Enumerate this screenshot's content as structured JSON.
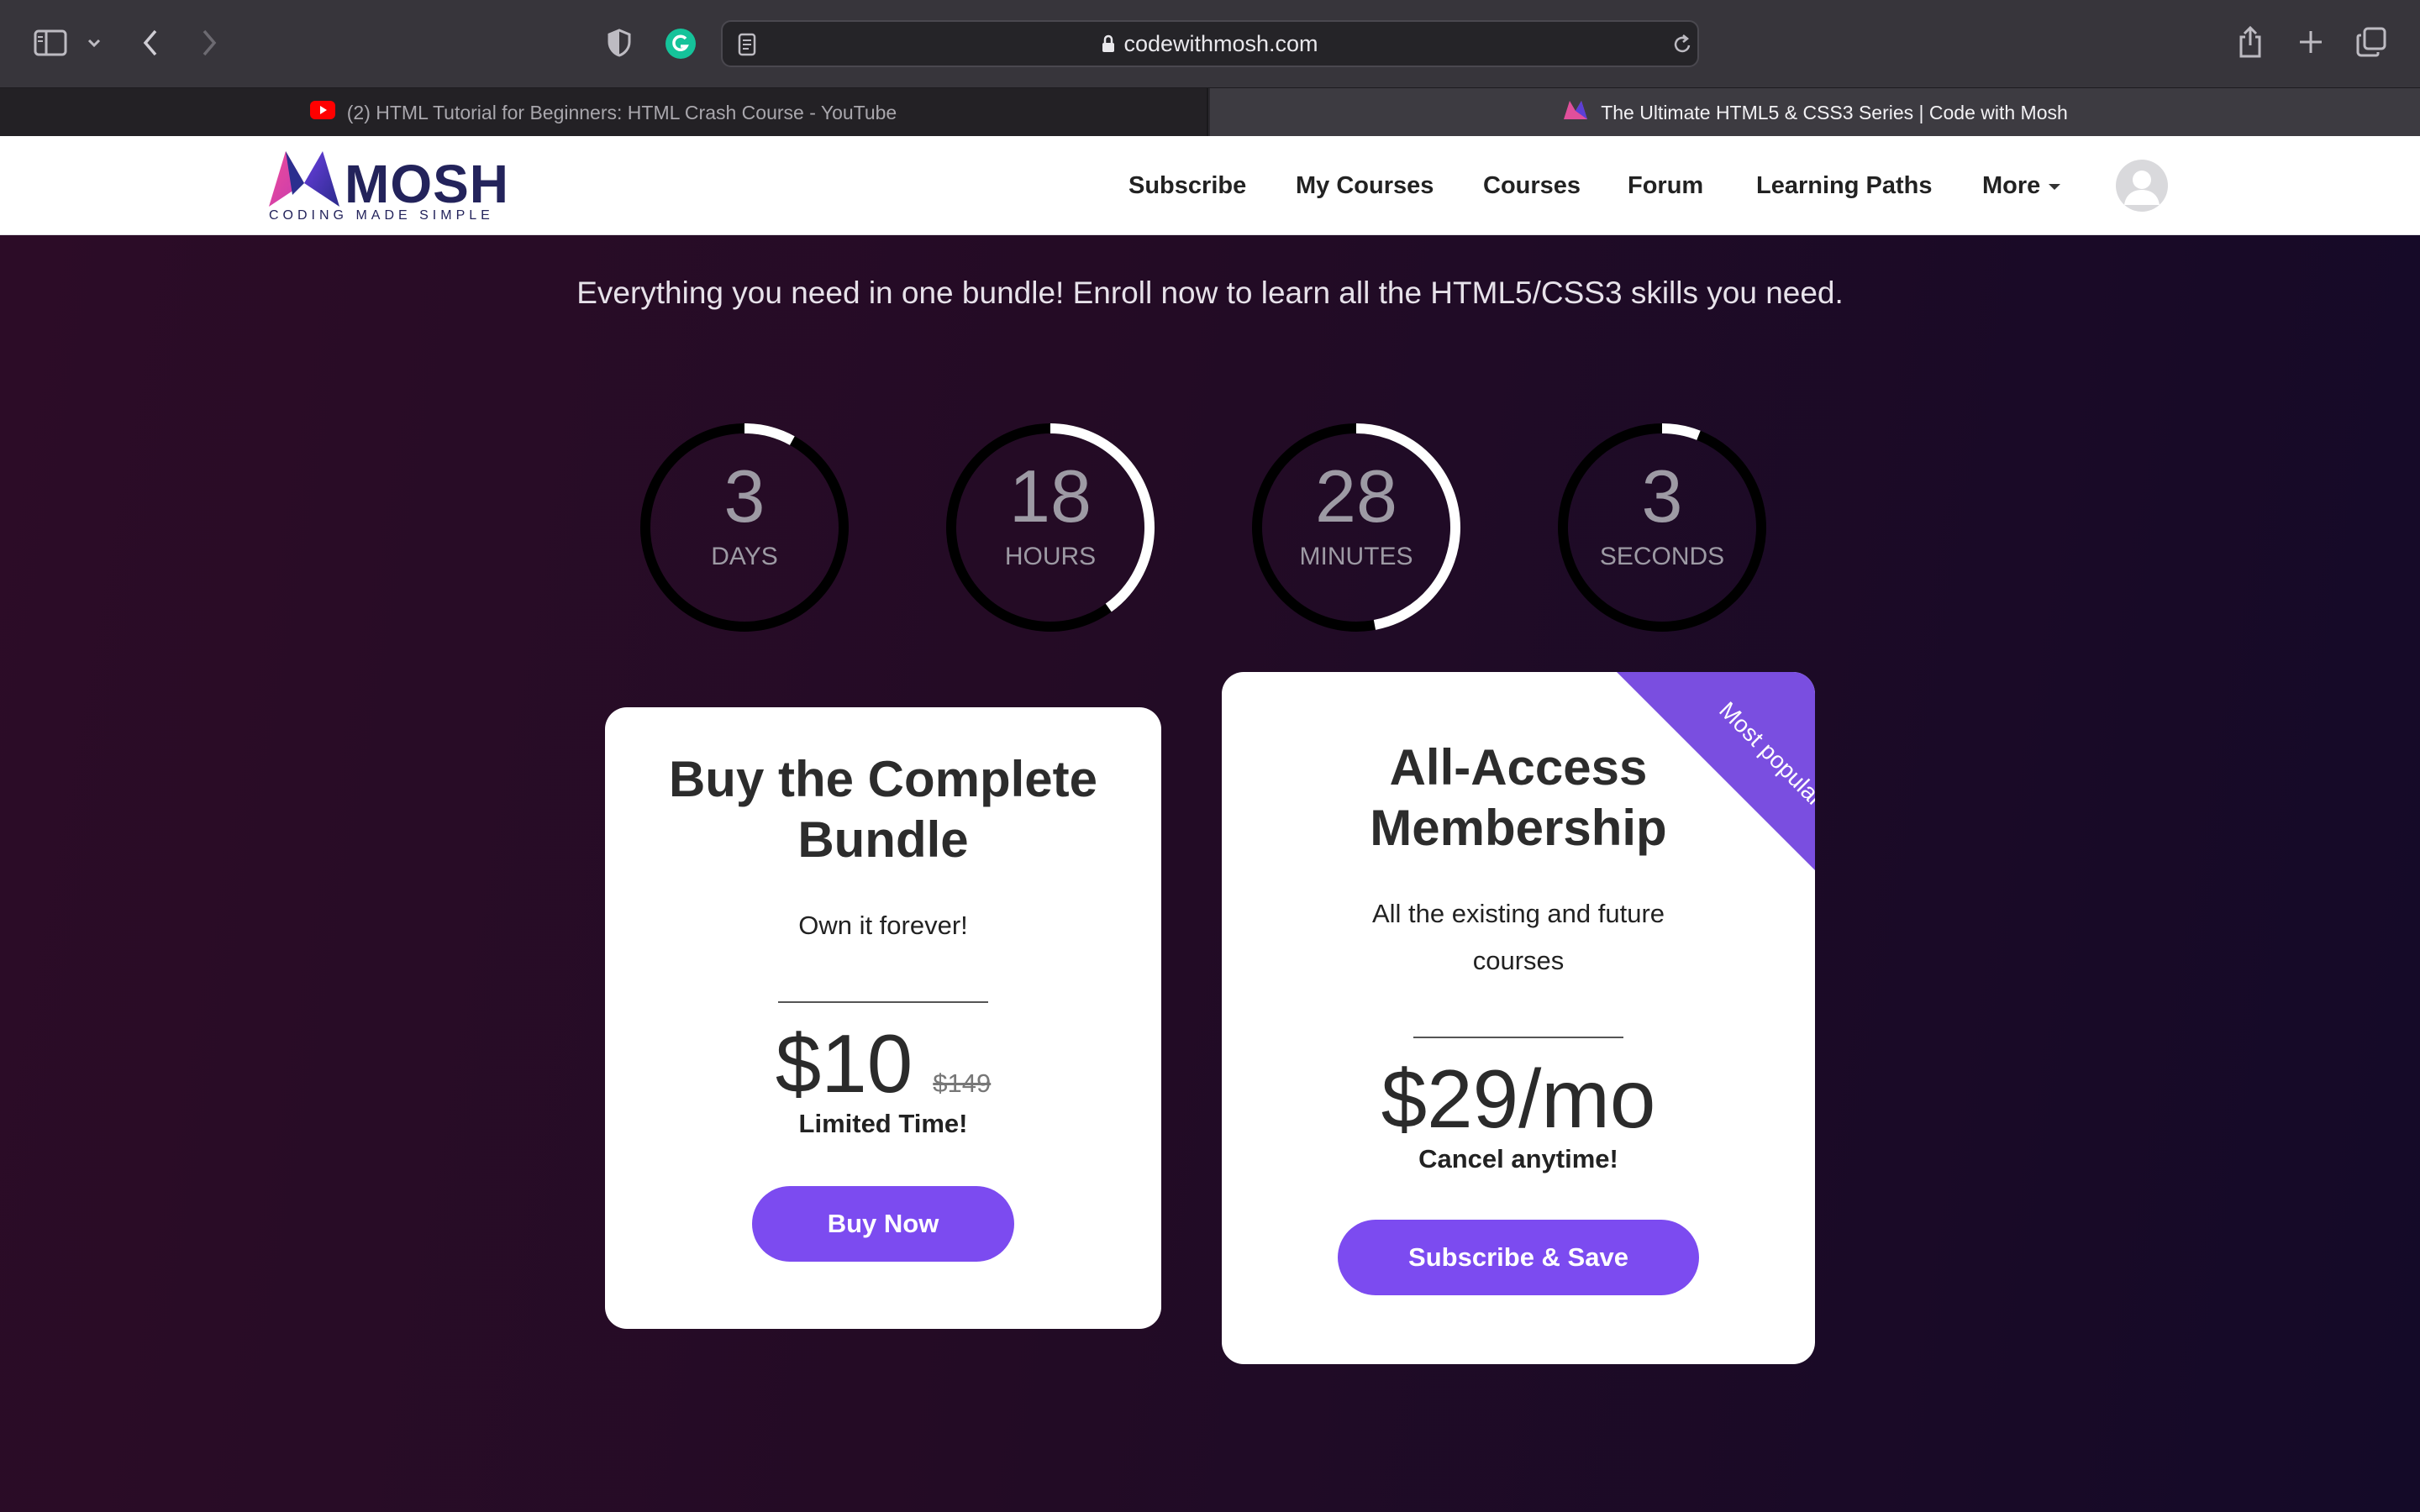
{
  "browser": {
    "url": "codewithmosh.com",
    "tabs": [
      {
        "title": "(2) HTML Tutorial for Beginners: HTML Crash Course - YouTube",
        "active": false
      },
      {
        "title": "The Ultimate HTML5 & CSS3 Series | Code with Mosh",
        "active": true
      }
    ]
  },
  "site": {
    "logo_word": "MOSH",
    "logo_tagline": "CODING MADE SIMPLE",
    "nav": {
      "subscribe": "Subscribe",
      "my_courses": "My Courses",
      "courses": "Courses",
      "forum": "Forum",
      "learning_paths": "Learning Paths",
      "more": "More"
    }
  },
  "hero": {
    "subtitle": "Everything you need in one bundle! Enroll now to learn all the HTML5/CSS3 skills you need."
  },
  "countdown": [
    {
      "value": "3",
      "label": "DAYS",
      "progress": 0.08
    },
    {
      "value": "18",
      "label": "HOURS",
      "progress": 0.4
    },
    {
      "value": "28",
      "label": "MINUTES",
      "progress": 0.47
    },
    {
      "value": "3",
      "label": "SECONDS",
      "progress": 0.06
    }
  ],
  "cards": {
    "bundle": {
      "title_line1": "Buy the Complete",
      "title_line2": "Bundle",
      "subtitle": "Own it forever!",
      "price": "$10",
      "old_price": "$149",
      "note": "Limited Time!",
      "button": "Buy Now"
    },
    "membership": {
      "ribbon": "Most popular",
      "title_line1": "All-Access",
      "title_line2": "Membership",
      "subtitle_line1": "All the existing and future",
      "subtitle_line2": "courses",
      "price": "$29/mo",
      "note": "Cancel anytime!",
      "button": "Subscribe & Save"
    }
  },
  "colors": {
    "accent": "#7c4bf0",
    "ribbon": "#7a4ee0",
    "hero_bg_left": "#2c0c27",
    "hero_bg_right": "#140a28"
  }
}
